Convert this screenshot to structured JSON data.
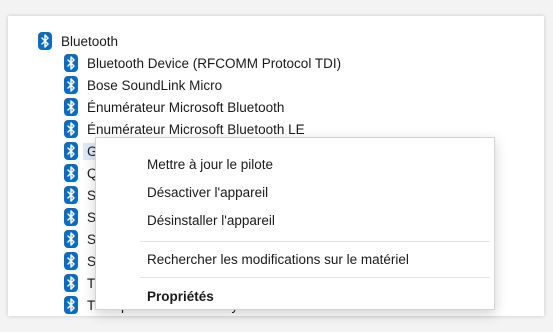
{
  "tree": {
    "category": {
      "label": "Bluetooth",
      "icon": "bluetooth-icon"
    },
    "devices": [
      {
        "label": "Bluetooth Device (RFCOMM Protocol TDI)"
      },
      {
        "label": "Bose SoundLink Micro"
      },
      {
        "label": "Énumérateur Microsoft Bluetooth"
      },
      {
        "label": "Énumérateur Microsoft Bluetooth LE"
      },
      {
        "label": "Ga...xy S8",
        "visible": "Ga"
      },
      {
        "label": "Qu",
        "visible": "Qu"
      },
      {
        "label": "Se",
        "visible": "Se"
      },
      {
        "label": "Se",
        "visible": "Se"
      },
      {
        "label": "Se",
        "visible": "Se"
      },
      {
        "label": "Se",
        "visible": "Se"
      },
      {
        "label": "Tra",
        "visible": "Tra"
      },
      {
        "label": "Transport AVRCP Galaxy S8",
        "visible": "Transport AVRCP Galaxy S8"
      }
    ]
  },
  "context_menu": {
    "update_driver": "Mettre à jour le pilote",
    "disable_device": "Désactiver l'appareil",
    "uninstall_device": "Désinstaller l'appareil",
    "scan_hardware": "Rechercher les modifications sur le matériel",
    "properties": "Propriétés"
  },
  "colors": {
    "accent": "#0f6cbd",
    "selection": "#dde9f7"
  }
}
